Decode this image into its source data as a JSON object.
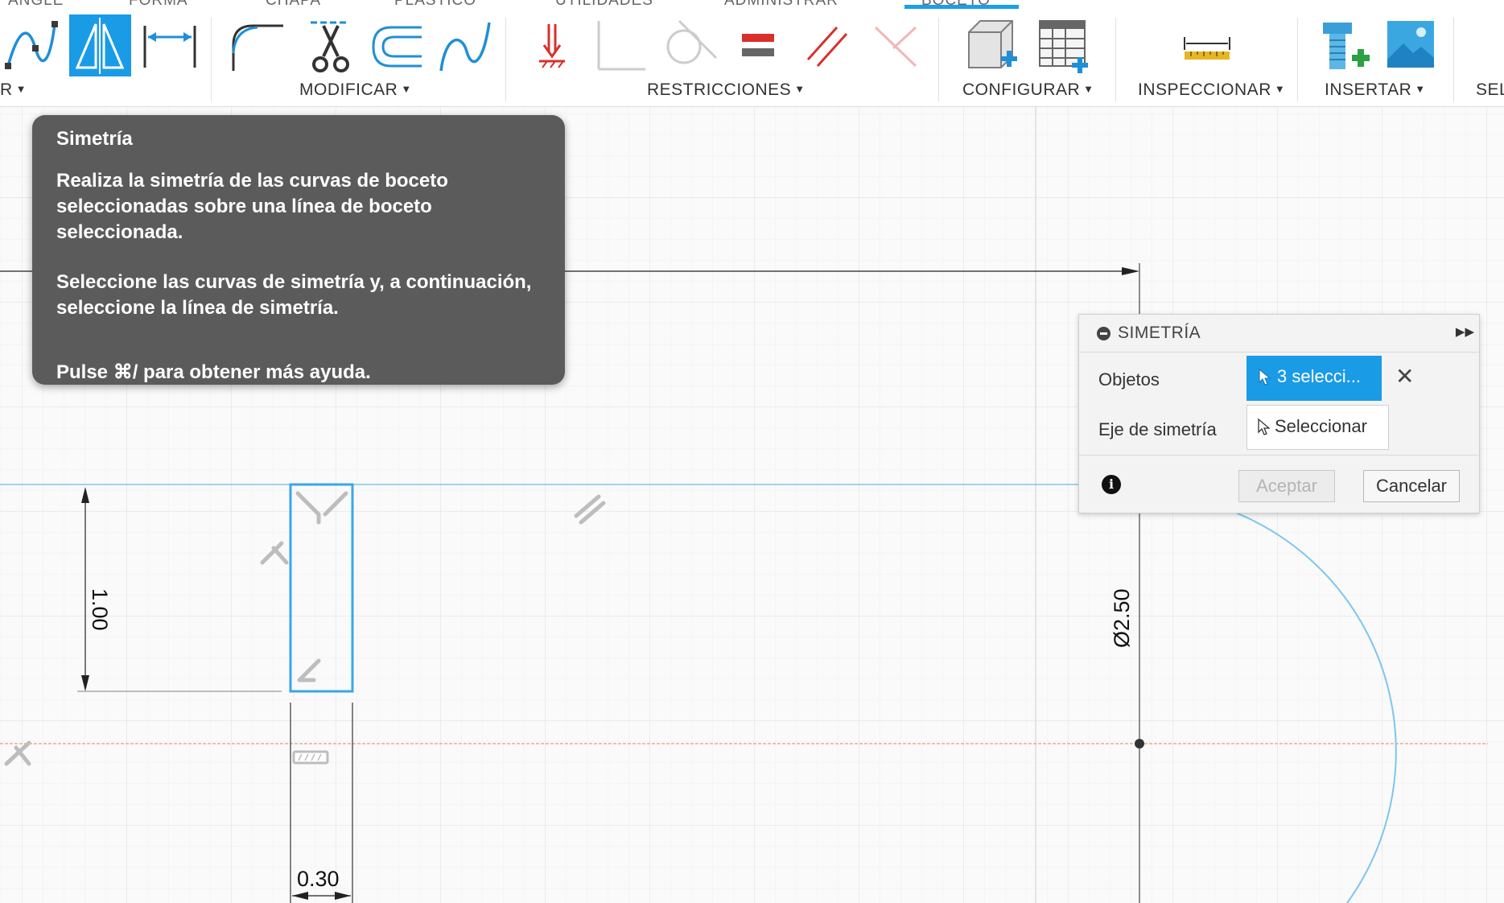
{
  "top_tabs": [
    "ÁNGLE",
    "FORMA",
    "CHAPA",
    "PLÁSTICO",
    "UTILIDADES",
    "ADMINISTRAR",
    "BOCETO"
  ],
  "toolbar": {
    "groups": [
      {
        "label": "R",
        "icons": [
          "spline-icon",
          "mirror-icon",
          "dimension-icon"
        ]
      },
      {
        "label": "MODIFICAR",
        "icons": [
          "fillet-icon",
          "trim-icon",
          "offset-icon",
          "extend-curve-icon"
        ]
      },
      {
        "label": "RESTRICCIONES",
        "icons": [
          "coincident-constraint-icon",
          "perpendicular-constraint-icon",
          "tangent-constraint-icon",
          "equal-constraint-icon",
          "parallel-constraint-icon",
          "perpendicular-lines-icon"
        ]
      },
      {
        "label": "CONFIGURAR",
        "icons": [
          "new-component-icon",
          "parameters-table-icon"
        ]
      },
      {
        "label": "INSPECCIONAR",
        "icons": [
          "measure-icon"
        ]
      },
      {
        "label": "INSERTAR",
        "icons": [
          "insert-bolt-icon",
          "insert-image-icon"
        ]
      },
      {
        "label": "SEL"
      }
    ]
  },
  "tooltip": {
    "title": "Simetría",
    "paragraph1": "Realiza la simetría de las curvas de boceto seleccionadas sobre una línea de boceto seleccionada.",
    "paragraph2": "Seleccione las curvas de simetría y, a continuación, seleccione la línea de simetría.",
    "help": "Pulse ⌘/ para obtener más ayuda."
  },
  "dialog": {
    "title": "SIMETRÍA",
    "objects_label": "Objetos",
    "objects_value": "3 selecci...",
    "axis_label": "Eje de simetría",
    "axis_value": "Seleccionar",
    "ok_label": "Aceptar",
    "cancel_label": "Cancelar"
  },
  "canvas": {
    "dim_height": "1.00",
    "dim_width": "0.30",
    "dim_diameter": "Ø2.50"
  },
  "colors": {
    "accent": "#1a9be6",
    "selection_blue": "#3aa6e8",
    "axis_red": "#e8a0a0"
  }
}
